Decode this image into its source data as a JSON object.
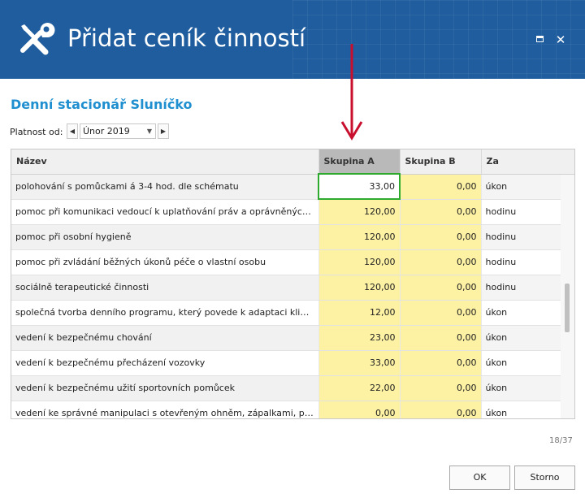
{
  "window": {
    "title": "Přidat ceník činností",
    "maximize_icon": "maximize-icon",
    "close_icon": "close-icon",
    "close_glyph": "✕"
  },
  "header": {
    "org_name": "Denní stacionář Sluníčko",
    "validity_label": "Platnost od:",
    "month_value": "Únor 2019"
  },
  "grid": {
    "columns": [
      "Název",
      "Skupina A",
      "Skupina B",
      "Za"
    ],
    "rows": [
      {
        "name": "polohování s pomůckami á 3-4 hod. dle schématu",
        "a": "33,00",
        "b": "0,00",
        "unit": "úkon"
      },
      {
        "name": "pomoc při komunikaci vedoucí k uplatňování práv a oprávněných zájmů",
        "a": "120,00",
        "b": "0,00",
        "unit": "hodinu"
      },
      {
        "name": "pomoc při osobní hygieně",
        "a": "120,00",
        "b": "0,00",
        "unit": "hodinu"
      },
      {
        "name": "pomoc při zvládání běžných úkonů péče o vlastní osobu",
        "a": "120,00",
        "b": "0,00",
        "unit": "hodinu"
      },
      {
        "name": "sociálně terapeutické činnosti",
        "a": "120,00",
        "b": "0,00",
        "unit": "hodinu"
      },
      {
        "name": "společná tvorba denního programu, který povede k adaptaci klienta",
        "a": "12,00",
        "b": "0,00",
        "unit": "úkon"
      },
      {
        "name": "vedení k bezpečnému chování",
        "a": "23,00",
        "b": "0,00",
        "unit": "úkon"
      },
      {
        "name": "vedení k bezpečnému přecházení vozovky",
        "a": "33,00",
        "b": "0,00",
        "unit": "úkon"
      },
      {
        "name": "vedení k bezpečnému užití sportovních pomůcek",
        "a": "22,00",
        "b": "0,00",
        "unit": "úkon"
      },
      {
        "name": "vedení ke správné manipulaci s otevřeným ohněm, zápalkami, plynovými...",
        "a": "0,00",
        "b": "0,00",
        "unit": "úkon"
      }
    ],
    "active_cell_value": "33,00"
  },
  "footer": {
    "counter": "18/37",
    "ok_label": "OK",
    "cancel_label": "Storno"
  },
  "colors": {
    "header_bg": "#1f5d9e",
    "org_text": "#1f8fd0",
    "editable_cell": "#fdf1a3",
    "active_border": "#2eaa2e",
    "annotation_arrow": "#c8102e"
  }
}
